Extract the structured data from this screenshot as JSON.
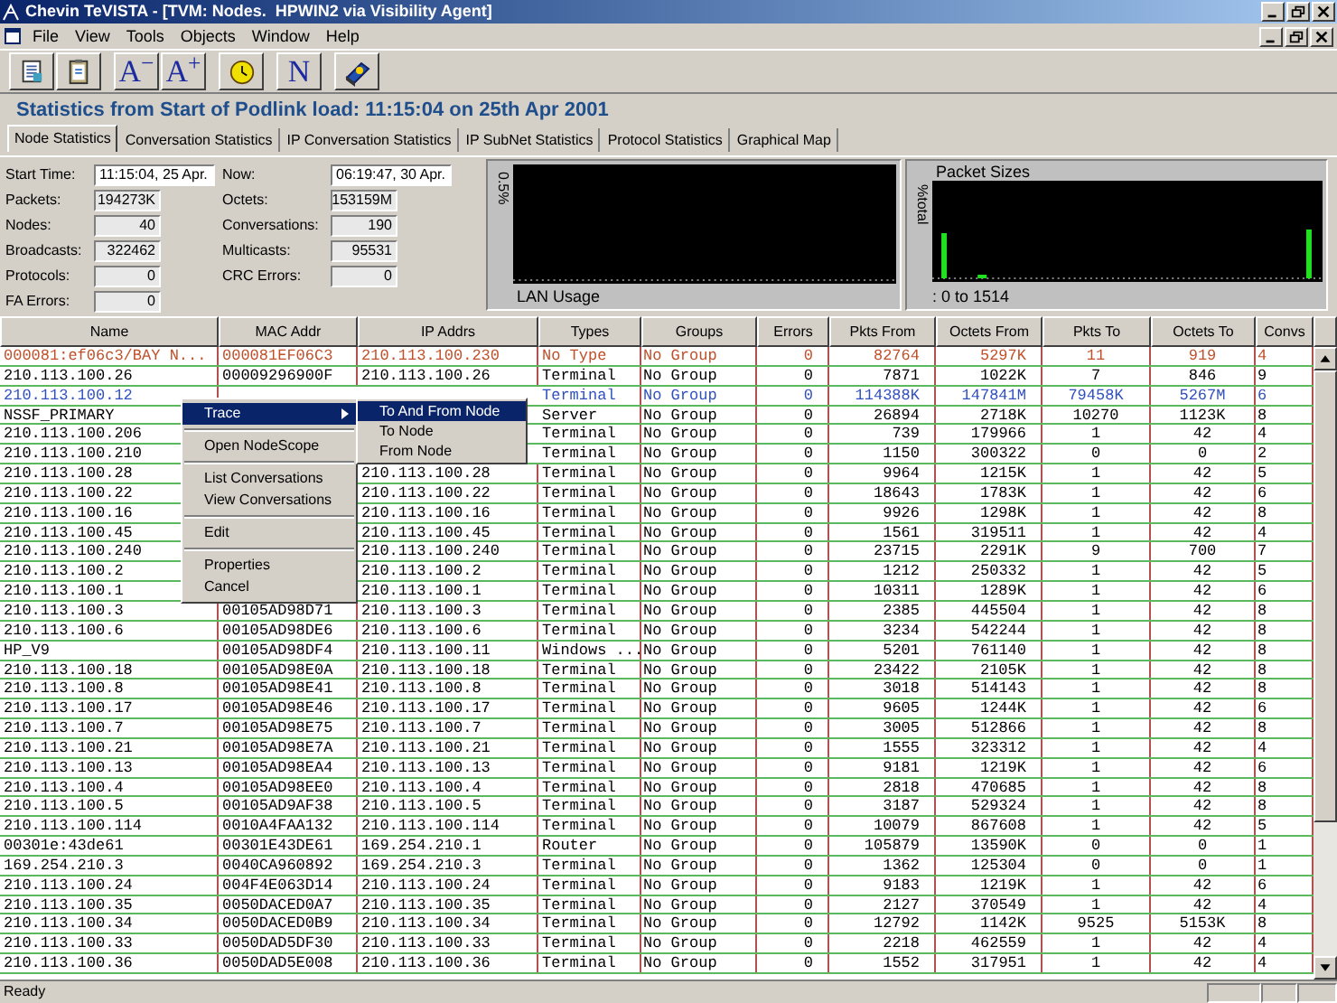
{
  "window": {
    "title": "Chevin TeVISTA - [TVM: Nodes.  HPWIN2 via Visibility Agent]"
  },
  "menu_bar": [
    "File",
    "View",
    "Tools",
    "Objects",
    "Window",
    "Help"
  ],
  "toolbar": [
    {
      "kind": "notes"
    },
    {
      "kind": "clipboard"
    },
    {
      "kind": "text",
      "label": "A$^{−}$"
    },
    {
      "kind": "text",
      "label": "A$^{+}$"
    },
    {
      "kind": "clock"
    },
    {
      "kind": "text",
      "label": "N"
    },
    {
      "kind": "help"
    }
  ],
  "heading": "Statistics from Start of Podlink load: 11:15:04 on 25th Apr 2001",
  "tabs": [
    {
      "label": "Node Statistics",
      "selected": true
    },
    {
      "label": "Conversation Statistics",
      "selected": false
    },
    {
      "label": "IP Conversation Statistics",
      "selected": false
    },
    {
      "label": "IP SubNet Statistics",
      "selected": false
    },
    {
      "label": "Protocol Statistics",
      "selected": false
    },
    {
      "label": "Graphical Map",
      "selected": false
    }
  ],
  "stats_left": [
    {
      "label": "Start Time:",
      "value": "11:15:04, 25 Apr.",
      "kind": "time"
    },
    {
      "label": "Packets:",
      "value": "194273K",
      "kind": "number"
    },
    {
      "label": "Nodes:",
      "value": "40",
      "kind": "number"
    },
    {
      "label": "Broadcasts:",
      "value": "322462",
      "kind": "number"
    },
    {
      "label": "Protocols:",
      "value": "0",
      "kind": "number"
    },
    {
      "label": "FA Errors:",
      "value": "0",
      "kind": "number"
    }
  ],
  "stats_right": [
    {
      "label": "Now:",
      "value": "06:19:47, 30 Apr.",
      "kind": "time"
    },
    {
      "label": "Octets:",
      "value": "153159M",
      "kind": "number"
    },
    {
      "label": "Conversations:",
      "value": "190",
      "kind": "number"
    },
    {
      "label": "Multicasts:",
      "value": "95531",
      "kind": "number"
    },
    {
      "label": "CRC Errors:",
      "value": "0",
      "kind": "number"
    }
  ],
  "lan_usage": {
    "title": "LAN Usage",
    "ylabel": "0.5%"
  },
  "packet_sizes": {
    "title": "Packet Sizes",
    "ylabel": "%total",
    "xlabel": ": 0 to 1514"
  },
  "table": {
    "columns": [
      "Name",
      "MAC Addr",
      "IP Addrs",
      "Types",
      "Groups",
      "Errors",
      "Pkts From",
      "Octets From",
      "Pkts To",
      "Octets To",
      "Convs"
    ],
    "rows": [
      {
        "color": "#c0502a",
        "name": "000081:ef06c3/BAY N...",
        "mac": "000081EF06C3",
        "ip": "210.113.100.230",
        "type": "No Type",
        "group": "No Group",
        "errors": "0",
        "pkts_from": "82764",
        "octets_from": "5297K",
        "pkts_to": "11",
        "octets_to": "919",
        "convs": "4"
      },
      {
        "color": "#000000",
        "name": "210.113.100.26",
        "mac": "00009296900F",
        "ip": "210.113.100.26",
        "type": "Terminal",
        "group": "No Group",
        "errors": "0",
        "pkts_from": "7871",
        "octets_from": "1022K",
        "pkts_to": "7",
        "octets_to": "846",
        "convs": "9"
      },
      {
        "color": "#3050c0",
        "name": "210.113.100.12",
        "type": "Terminal",
        "group": "No Group",
        "errors": "0",
        "pkts_from": "114388K",
        "octets_from": "147841M",
        "pkts_to": "79458K",
        "octets_to": "5267M",
        "convs": "6"
      },
      {
        "color": "#000000",
        "name": "NSSF_PRIMARY",
        "type": "Server",
        "group": "No Group",
        "errors": "0",
        "pkts_from": "26894",
        "octets_from": "2718K",
        "pkts_to": "10270",
        "octets_to": "1123K",
        "convs": "8"
      },
      {
        "color": "#000000",
        "name": "210.113.100.206",
        "type": "Terminal",
        "group": "No Group",
        "errors": "0",
        "pkts_from": "739",
        "octets_from": "179966",
        "pkts_to": "1",
        "octets_to": "42",
        "convs": "4"
      },
      {
        "color": "#000000",
        "name": "210.113.100.210",
        "type": "Terminal",
        "group": "No Group",
        "errors": "0",
        "pkts_from": "1150",
        "octets_from": "300322",
        "pkts_to": "0",
        "octets_to": "0",
        "convs": "2"
      },
      {
        "color": "#000000",
        "name": "210.113.100.28",
        "ip": "210.113.100.28",
        "type": "Terminal",
        "group": "No Group",
        "errors": "0",
        "pkts_from": "9964",
        "octets_from": "1215K",
        "pkts_to": "1",
        "octets_to": "42",
        "convs": "5"
      },
      {
        "color": "#000000",
        "name": "210.113.100.22",
        "ip": "210.113.100.22",
        "type": "Terminal",
        "group": "No Group",
        "errors": "0",
        "pkts_from": "18643",
        "octets_from": "1783K",
        "pkts_to": "1",
        "octets_to": "42",
        "convs": "6"
      },
      {
        "color": "#000000",
        "name": "210.113.100.16",
        "ip": "210.113.100.16",
        "type": "Terminal",
        "group": "No Group",
        "errors": "0",
        "pkts_from": "9926",
        "octets_from": "1298K",
        "pkts_to": "1",
        "octets_to": "42",
        "convs": "8"
      },
      {
        "color": "#000000",
        "name": "210.113.100.45",
        "ip": "210.113.100.45",
        "type": "Terminal",
        "group": "No Group",
        "errors": "0",
        "pkts_from": "1561",
        "octets_from": "319511",
        "pkts_to": "1",
        "octets_to": "42",
        "convs": "4"
      },
      {
        "color": "#000000",
        "name": "210.113.100.240",
        "ip": "210.113.100.240",
        "type": "Terminal",
        "group": "No Group",
        "errors": "0",
        "pkts_from": "23715",
        "octets_from": "2291K",
        "pkts_to": "9",
        "octets_to": "700",
        "convs": "7"
      },
      {
        "color": "#000000",
        "name": "210.113.100.2",
        "ip": "210.113.100.2",
        "type": "Terminal",
        "group": "No Group",
        "errors": "0",
        "pkts_from": "1212",
        "octets_from": "250332",
        "pkts_to": "1",
        "octets_to": "42",
        "convs": "5"
      },
      {
        "color": "#000000",
        "name": "210.113.100.1",
        "ip": "210.113.100.1",
        "type": "Terminal",
        "group": "No Group",
        "errors": "0",
        "pkts_from": "10311",
        "octets_from": "1289K",
        "pkts_to": "1",
        "octets_to": "42",
        "convs": "6"
      },
      {
        "color": "#000000",
        "name": "210.113.100.3",
        "mac": "00105AD98D71",
        "ip": "210.113.100.3",
        "type": "Terminal",
        "group": "No Group",
        "errors": "0",
        "pkts_from": "2385",
        "octets_from": "445504",
        "pkts_to": "1",
        "octets_to": "42",
        "convs": "8"
      },
      {
        "color": "#000000",
        "name": "210.113.100.6",
        "mac": "00105AD98DE6",
        "ip": "210.113.100.6",
        "type": "Terminal",
        "group": "No Group",
        "errors": "0",
        "pkts_from": "3234",
        "octets_from": "542244",
        "pkts_to": "1",
        "octets_to": "42",
        "convs": "8"
      },
      {
        "color": "#000000",
        "name": "HP_V9",
        "mac": "00105AD98DF4",
        "ip": "210.113.100.11",
        "type": "Windows ...",
        "group": "No Group",
        "errors": "0",
        "pkts_from": "5201",
        "octets_from": "761140",
        "pkts_to": "1",
        "octets_to": "42",
        "convs": "8"
      },
      {
        "color": "#000000",
        "name": "210.113.100.18",
        "mac": "00105AD98E0A",
        "ip": "210.113.100.18",
        "type": "Terminal",
        "group": "No Group",
        "errors": "0",
        "pkts_from": "23422",
        "octets_from": "2105K",
        "pkts_to": "1",
        "octets_to": "42",
        "convs": "8"
      },
      {
        "color": "#000000",
        "name": "210.113.100.8",
        "mac": "00105AD98E41",
        "ip": "210.113.100.8",
        "type": "Terminal",
        "group": "No Group",
        "errors": "0",
        "pkts_from": "3018",
        "octets_from": "514143",
        "pkts_to": "1",
        "octets_to": "42",
        "convs": "8"
      },
      {
        "color": "#000000",
        "name": "210.113.100.17",
        "mac": "00105AD98E46",
        "ip": "210.113.100.17",
        "type": "Terminal",
        "group": "No Group",
        "errors": "0",
        "pkts_from": "9605",
        "octets_from": "1244K",
        "pkts_to": "1",
        "octets_to": "42",
        "convs": "6"
      },
      {
        "color": "#000000",
        "name": "210.113.100.7",
        "mac": "00105AD98E75",
        "ip": "210.113.100.7",
        "type": "Terminal",
        "group": "No Group",
        "errors": "0",
        "pkts_from": "3005",
        "octets_from": "512866",
        "pkts_to": "1",
        "octets_to": "42",
        "convs": "8"
      },
      {
        "color": "#000000",
        "name": "210.113.100.21",
        "mac": "00105AD98E7A",
        "ip": "210.113.100.21",
        "type": "Terminal",
        "group": "No Group",
        "errors": "0",
        "pkts_from": "1555",
        "octets_from": "323312",
        "pkts_to": "1",
        "octets_to": "42",
        "convs": "4"
      },
      {
        "color": "#000000",
        "name": "210.113.100.13",
        "mac": "00105AD98EA4",
        "ip": "210.113.100.13",
        "type": "Terminal",
        "group": "No Group",
        "errors": "0",
        "pkts_from": "9181",
        "octets_from": "1219K",
        "pkts_to": "1",
        "octets_to": "42",
        "convs": "6"
      },
      {
        "color": "#000000",
        "name": "210.113.100.4",
        "mac": "00105AD98EE0",
        "ip": "210.113.100.4",
        "type": "Terminal",
        "group": "No Group",
        "errors": "0",
        "pkts_from": "2818",
        "octets_from": "470685",
        "pkts_to": "1",
        "octets_to": "42",
        "convs": "8"
      },
      {
        "color": "#000000",
        "name": "210.113.100.5",
        "mac": "00105AD9AF38",
        "ip": "210.113.100.5",
        "type": "Terminal",
        "group": "No Group",
        "errors": "0",
        "pkts_from": "3187",
        "octets_from": "529324",
        "pkts_to": "1",
        "octets_to": "42",
        "convs": "8"
      },
      {
        "color": "#000000",
        "name": "210.113.100.114",
        "mac": "0010A4FAA132",
        "ip": "210.113.100.114",
        "type": "Terminal",
        "group": "No Group",
        "errors": "0",
        "pkts_from": "10079",
        "octets_from": "867608",
        "pkts_to": "1",
        "octets_to": "42",
        "convs": "5"
      },
      {
        "color": "#000000",
        "name": "00301e:43de61",
        "mac": "00301E43DE61",
        "ip": "169.254.210.1",
        "type": "Router",
        "group": "No Group",
        "errors": "0",
        "pkts_from": "105879",
        "octets_from": "13590K",
        "pkts_to": "0",
        "octets_to": "0",
        "convs": "1"
      },
      {
        "color": "#000000",
        "name": "169.254.210.3",
        "mac": "0040CA960892",
        "ip": "169.254.210.3",
        "type": "Terminal",
        "group": "No Group",
        "errors": "0",
        "pkts_from": "1362",
        "octets_from": "125304",
        "pkts_to": "0",
        "octets_to": "0",
        "convs": "1"
      },
      {
        "color": "#000000",
        "name": "210.113.100.24",
        "mac": "004F4E063D14",
        "ip": "210.113.100.24",
        "type": "Terminal",
        "group": "No Group",
        "errors": "0",
        "pkts_from": "9183",
        "octets_from": "1219K",
        "pkts_to": "1",
        "octets_to": "42",
        "convs": "6"
      },
      {
        "color": "#000000",
        "name": "210.113.100.35",
        "mac": "0050DACED0A7",
        "ip": "210.113.100.35",
        "type": "Terminal",
        "group": "No Group",
        "errors": "0",
        "pkts_from": "2127",
        "octets_from": "370549",
        "pkts_to": "1",
        "octets_to": "42",
        "convs": "4"
      },
      {
        "color": "#000000",
        "name": "210.113.100.34",
        "mac": "0050DACED0B9",
        "ip": "210.113.100.34",
        "type": "Terminal",
        "group": "No Group",
        "errors": "0",
        "pkts_from": "12792",
        "octets_from": "1142K",
        "pkts_to": "9525",
        "octets_to": "5153K",
        "convs": "8"
      },
      {
        "color": "#000000",
        "name": "210.113.100.33",
        "mac": "0050DAD5DF30",
        "ip": "210.113.100.33",
        "type": "Terminal",
        "group": "No Group",
        "errors": "0",
        "pkts_from": "2218",
        "octets_from": "462559",
        "pkts_to": "1",
        "octets_to": "42",
        "convs": "4"
      },
      {
        "color": "#000000",
        "name": "210.113.100.36",
        "mac": "0050DAD5E008",
        "ip": "210.113.100.36",
        "type": "Terminal",
        "group": "No Group",
        "errors": "0",
        "pkts_from": "1552",
        "octets_from": "317951",
        "pkts_to": "1",
        "octets_to": "42",
        "convs": "4"
      }
    ]
  },
  "context_menu": [
    {
      "kind": "item",
      "label": "Trace",
      "selected": true,
      "submenu": true
    },
    {
      "kind": "separator"
    },
    {
      "kind": "item",
      "label": "Open NodeScope",
      "selected": false,
      "submenu": false
    },
    {
      "kind": "separator"
    },
    {
      "kind": "item",
      "label": "List Conversations",
      "selected": false,
      "submenu": false
    },
    {
      "kind": "item",
      "label": "View Conversations",
      "selected": false,
      "submenu": false
    },
    {
      "kind": "separator"
    },
    {
      "kind": "item",
      "label": "Edit",
      "selected": false,
      "submenu": false
    },
    {
      "kind": "separator"
    },
    {
      "kind": "item",
      "label": "Properties",
      "selected": false,
      "submenu": false
    },
    {
      "kind": "item",
      "label": "Cancel",
      "selected": false,
      "submenu": false
    }
  ],
  "submenu": [
    {
      "label": "To And From Node",
      "selected": true
    },
    {
      "label": "To Node",
      "selected": false
    },
    {
      "label": "From Node",
      "selected": false
    }
  ],
  "status_bar": {
    "text": "Ready"
  }
}
